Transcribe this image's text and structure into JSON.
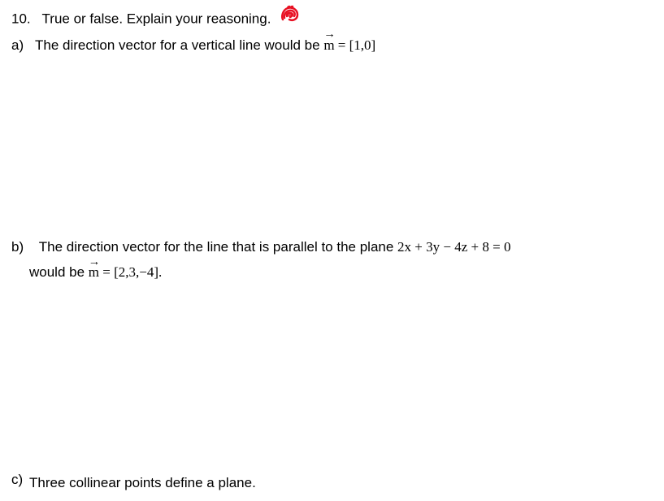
{
  "question": {
    "number": "10.",
    "prompt": "True or false.  Explain your reasoning."
  },
  "parts": {
    "a": {
      "label": "a)",
      "text_before": "The direction vector for a vertical line would be ",
      "vector_symbol": "m",
      "vector_value": " = [1,0]"
    },
    "b": {
      "label": "b)",
      "line1_before": "The direction vector for the line that is parallel to the plane ",
      "plane_equation": "2x + 3y − 4z + 8 = 0",
      "line2_before": "would be ",
      "vector_symbol": "m",
      "vector_value": " = [2,3,−4]."
    },
    "c": {
      "label": "c)",
      "text": "Three collinear points define a plane."
    }
  },
  "annotation": {
    "name": "red-scribble-annotation",
    "color": "#e81123"
  }
}
